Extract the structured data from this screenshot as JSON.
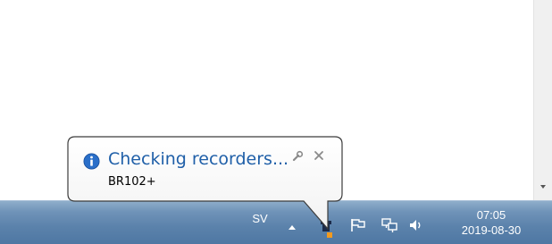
{
  "notification": {
    "title": "Checking recorders...",
    "subtitle": "BR102+",
    "icons": {
      "info": "info-icon",
      "options": "wrench-icon",
      "close": "close-icon"
    }
  },
  "taskbar": {
    "language": "SV",
    "clock": {
      "time": "07:05",
      "date": "2019-08-30"
    },
    "tray_icons": [
      "chevron-up-icon",
      "app-tray-icon",
      "flag-icon",
      "network-icon",
      "speaker-icon"
    ]
  },
  "colors": {
    "taskbar_top": "#8faecb",
    "taskbar_bottom": "#4e77a3",
    "balloon_title": "#1f5fa8",
    "info_blue": "#2a6fc9"
  }
}
